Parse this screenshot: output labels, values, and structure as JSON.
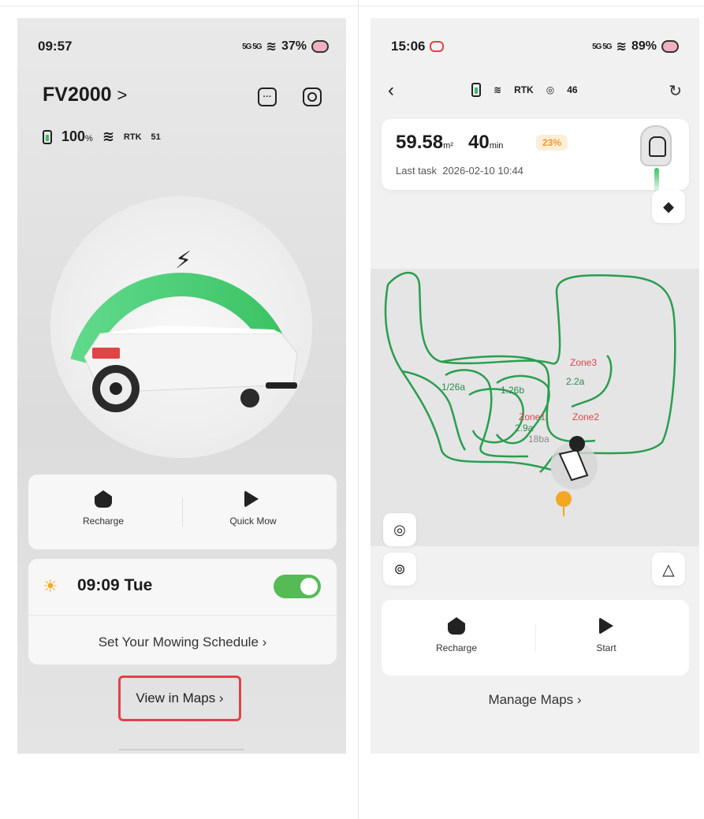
{
  "left": {
    "status": {
      "time": "09:57",
      "net": "5G 5G",
      "battery": "37%"
    },
    "device_name": "FV2000",
    "device_arrow": ">",
    "stats": {
      "battery": "100",
      "battery_unit": "%",
      "rtk": "RTK",
      "signal": "51"
    },
    "actions": [
      {
        "label": "Recharge",
        "icon": "recharge-icon"
      },
      {
        "label": "Quick Mow",
        "icon": "play-icon"
      }
    ],
    "schedule": {
      "time": "09:09 Tue",
      "enabled": true,
      "link": "Set Your Mowing Schedule"
    },
    "view_maps": "View in Maps"
  },
  "right": {
    "status": {
      "time": "15:06",
      "net": "5G 5G",
      "battery": "89%"
    },
    "task": {
      "area": "59.58",
      "area_unit": "m²",
      "duration": "40",
      "duration_unit": "min",
      "progress": "23%",
      "last_task_label": "Last task",
      "last_task_time": "2026-02-10 10:44"
    },
    "map_labels": {
      "zones": [
        "Zone3",
        "Zone2",
        "Zone1"
      ],
      "areas": [
        "1/26a",
        "1.26b",
        "2.2a",
        "2.9a",
        "18ba"
      ]
    },
    "actions": [
      {
        "label": "Recharge",
        "icon": "recharge-icon"
      },
      {
        "label": "Start",
        "icon": "play-icon"
      }
    ],
    "manage_maps": "Manage Maps"
  },
  "colors": {
    "accent_green": "#56bb55",
    "highlight_red": "#e0424b",
    "progress_orange": "#f09a30",
    "map_path": "#2a9e4f"
  }
}
